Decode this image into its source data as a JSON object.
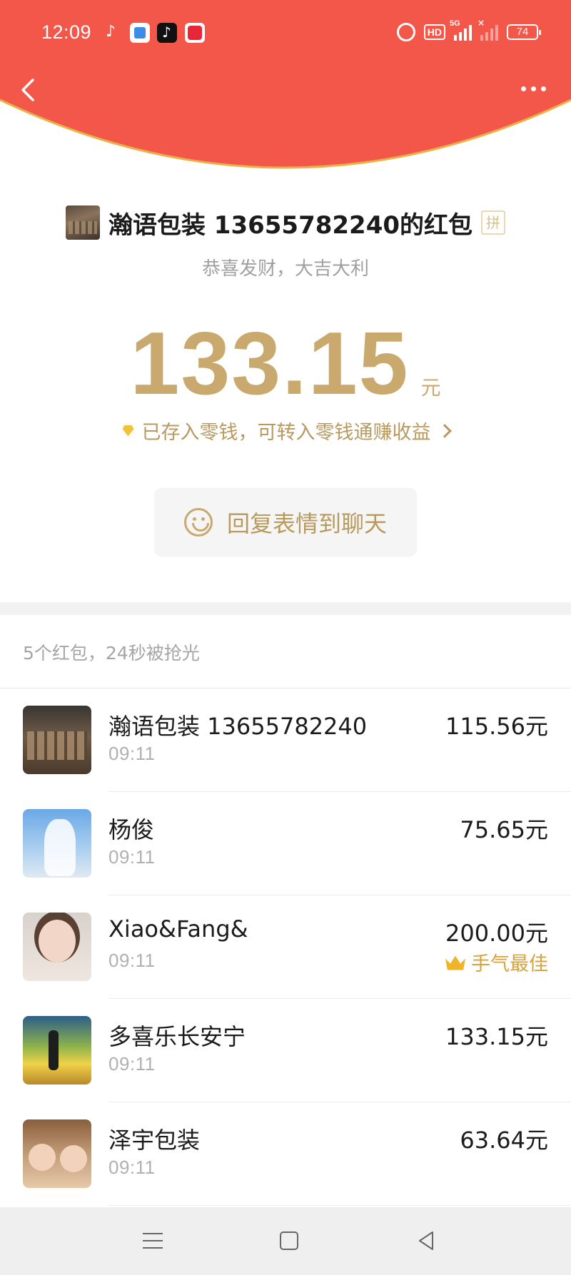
{
  "status_bar": {
    "time": "12:09",
    "network": "5G",
    "hd_label": "HD",
    "battery": "74"
  },
  "colors": {
    "header_red": "#f2574a",
    "gold": "#c9a96d",
    "gold_text": "#b8995e",
    "best_luck": "#d9a13a"
  },
  "icons": {
    "back": "chevron-left-icon",
    "more": "more-dots-icon",
    "pin": "pin-badge-icon",
    "diamond": "diamond-icon",
    "smile": "smile-icon",
    "crown": "crown-icon"
  },
  "packet": {
    "sender_title": "瀚语包装 13655782240的红包",
    "pin_badge": "拼",
    "blessing": "恭喜发财，大吉大利",
    "amount": "133.15",
    "unit": "元",
    "deposit_text": "已存入零钱，可转入零钱通赚收益",
    "reply_label": "回复表情到聊天"
  },
  "summary": "5个红包，24秒被抢光",
  "receivers": [
    {
      "name": "瀚语包装 13655782240",
      "time": "09:11",
      "amount": "115.56元",
      "best": ""
    },
    {
      "name": "杨俊",
      "time": "09:11",
      "amount": "75.65元",
      "best": ""
    },
    {
      "name": "Xiao&Fang&",
      "time": "09:11",
      "amount": "200.00元",
      "best": "手气最佳"
    },
    {
      "name": "多喜乐长安宁",
      "time": "09:11",
      "amount": "133.15元",
      "best": ""
    },
    {
      "name": "泽宇包装",
      "time": "09:11",
      "amount": "63.64元",
      "best": ""
    }
  ]
}
